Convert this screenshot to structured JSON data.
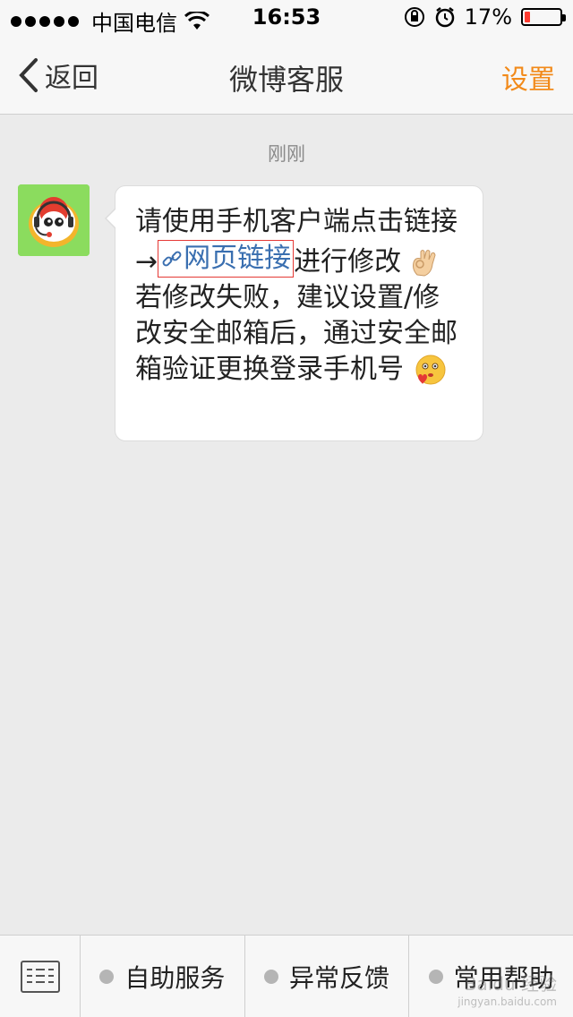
{
  "status_bar": {
    "carrier": "中国电信",
    "time": "16:53",
    "battery_percent": "17%",
    "battery_level": 0.17,
    "icons": [
      "signal-dots-icon",
      "wifi-icon",
      "rotation-lock-icon",
      "alarm-icon",
      "battery-icon"
    ]
  },
  "nav": {
    "back_label": "返回",
    "title": "微博客服",
    "settings_label": "设置"
  },
  "chat": {
    "timestamp": "刚刚",
    "message": {
      "line1": "请使用手机客户端点击链接→",
      "link_label": "网页链接",
      "line2": "进行修改",
      "line3": "若修改失败，建议设置/修改安全邮箱后，通过安全邮箱验证更换登录手机号"
    }
  },
  "bottom_bar": {
    "items": [
      {
        "label": "自助服务"
      },
      {
        "label": "异常反馈"
      },
      {
        "label": "常用帮助"
      }
    ]
  },
  "watermark": {
    "text": "Baidu 经验",
    "sub": "jingyan.baidu.com"
  },
  "colors": {
    "accent": "#f28a1a",
    "link": "#3a6fb0",
    "battery_low": "#ff3b30",
    "background": "#ebebeb"
  }
}
